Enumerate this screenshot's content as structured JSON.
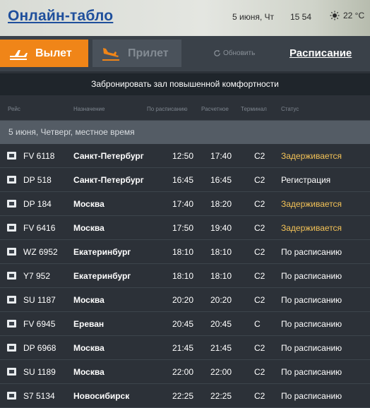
{
  "header": {
    "title": "Онлайн-табло",
    "date": "5 июня, Чт",
    "time": "15  54",
    "temperature": "22 °C"
  },
  "tabs": {
    "departure": "Вылет",
    "arrival": "Прилет",
    "refresh": "Обновить",
    "schedule": "Расписание"
  },
  "banner": "Забронировать зал повышенной комфортности",
  "columns": {
    "flight": "Рейс",
    "destination": "Назначение",
    "scheduled": "По расписанию",
    "estimated": "Расчетное",
    "terminal": "Терминал",
    "status": "Статус"
  },
  "date_row": "5 июня, Четверг, местное время",
  "flights": [
    {
      "flight": "FV 6118",
      "destination": "Санкт-Петербург",
      "scheduled": "12:50",
      "estimated": "17:40",
      "terminal": "C2",
      "status": "Задерживается"
    },
    {
      "flight": "DP 518",
      "destination": "Санкт-Петербург",
      "scheduled": "16:45",
      "estimated": "16:45",
      "terminal": "C2",
      "status": "Регистрация"
    },
    {
      "flight": "DP 184",
      "destination": "Москва",
      "scheduled": "17:40",
      "estimated": "18:20",
      "terminal": "C2",
      "status": "Задерживается"
    },
    {
      "flight": "FV 6416",
      "destination": "Москва",
      "scheduled": "17:50",
      "estimated": "19:40",
      "terminal": "C2",
      "status": "Задерживается"
    },
    {
      "flight": "WZ 6952",
      "destination": "Екатеринбург",
      "scheduled": "18:10",
      "estimated": "18:10",
      "terminal": "C2",
      "status": "По расписанию"
    },
    {
      "flight": "Y7 952",
      "destination": "Екатеринбург",
      "scheduled": "18:10",
      "estimated": "18:10",
      "terminal": "C2",
      "status": "По расписанию"
    },
    {
      "flight": "SU 1187",
      "destination": "Москва",
      "scheduled": "20:20",
      "estimated": "20:20",
      "terminal": "C2",
      "status": "По расписанию"
    },
    {
      "flight": "FV 6945",
      "destination": "Ереван",
      "scheduled": "20:45",
      "estimated": "20:45",
      "terminal": "C",
      "status": "По расписанию"
    },
    {
      "flight": "DP 6968",
      "destination": "Москва",
      "scheduled": "21:45",
      "estimated": "21:45",
      "terminal": "C2",
      "status": "По расписанию"
    },
    {
      "flight": "SU 1189",
      "destination": "Москва",
      "scheduled": "22:00",
      "estimated": "22:00",
      "terminal": "C2",
      "status": "По расписанию"
    },
    {
      "flight": "S7 5134",
      "destination": "Новосибирск",
      "scheduled": "22:25",
      "estimated": "22:25",
      "terminal": "C2",
      "status": "По расписанию"
    }
  ],
  "colors": {
    "accent": "#f08518",
    "delayed": "#f3c257",
    "title": "#1f4f9c"
  },
  "icons": {
    "weather": "sun-icon",
    "departure": "plane-takeoff-icon",
    "arrival": "plane-landing-icon",
    "refresh": "refresh-icon",
    "airline": "airline-logo-icon"
  }
}
